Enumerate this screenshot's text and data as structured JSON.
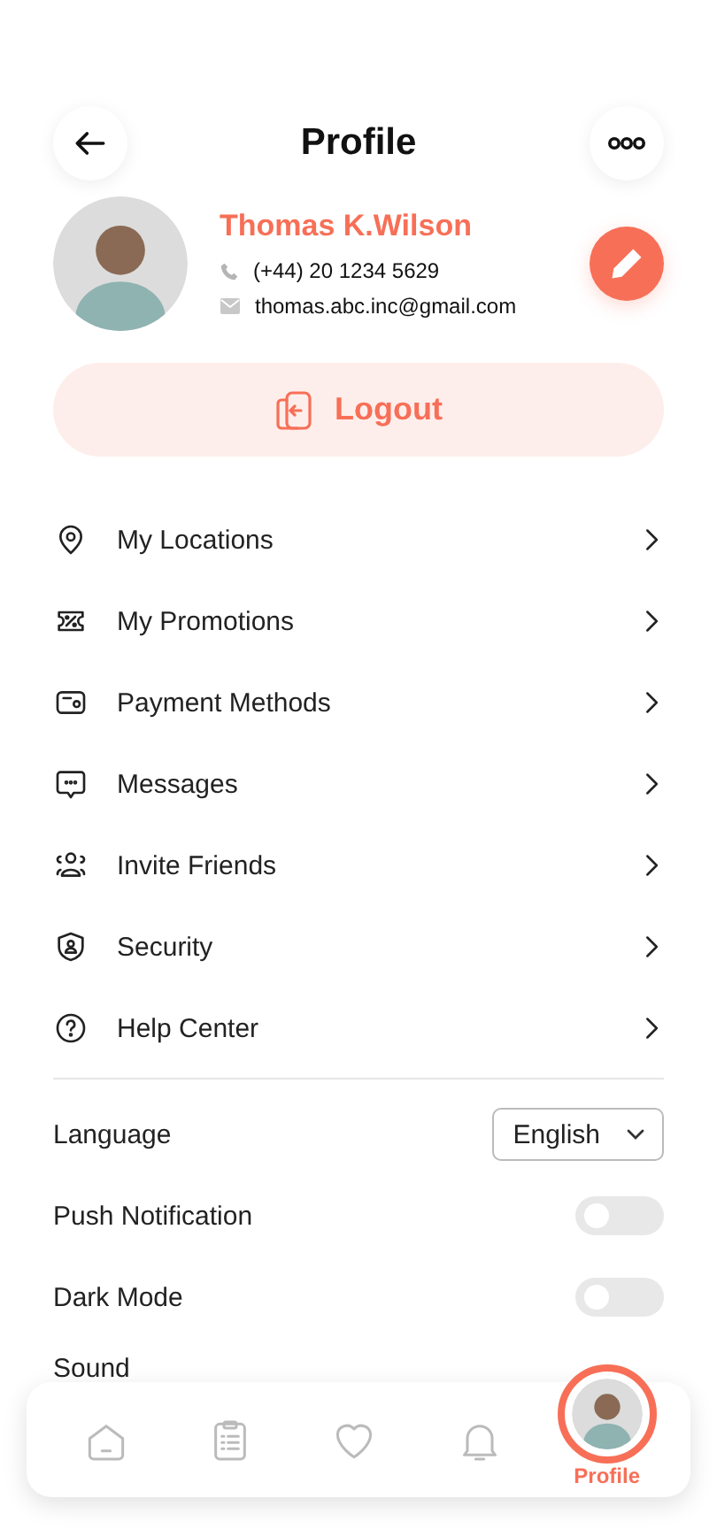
{
  "header": {
    "title": "Profile"
  },
  "profile": {
    "name": "Thomas K.Wilson",
    "phone": "(+44)  20 1234 5629",
    "email": "thomas.abc.inc@gmail.com"
  },
  "logout": {
    "label": "Logout"
  },
  "menu": [
    {
      "kind": "location",
      "label": "My Locations"
    },
    {
      "kind": "promotion",
      "label": "My Promotions"
    },
    {
      "kind": "wallet",
      "label": "Payment Methods"
    },
    {
      "kind": "message",
      "label": "Messages"
    },
    {
      "kind": "friends",
      "label": "Invite Friends"
    },
    {
      "kind": "security",
      "label": "Security"
    },
    {
      "kind": "help",
      "label": "Help Center"
    }
  ],
  "settings": [
    {
      "kind": "select",
      "label": "Language",
      "value": "English"
    },
    {
      "kind": "toggle",
      "label": "Push Notification",
      "on": false
    },
    {
      "kind": "toggle",
      "label": "Dark Mode",
      "on": false
    },
    {
      "kind": "label",
      "label": "Sound"
    }
  ],
  "nav": [
    {
      "kind": "home",
      "selected": false
    },
    {
      "kind": "orders",
      "selected": false
    },
    {
      "kind": "favorites",
      "selected": false
    },
    {
      "kind": "notifications",
      "selected": false
    },
    {
      "kind": "profile",
      "label": "Profile",
      "selected": true
    }
  ]
}
